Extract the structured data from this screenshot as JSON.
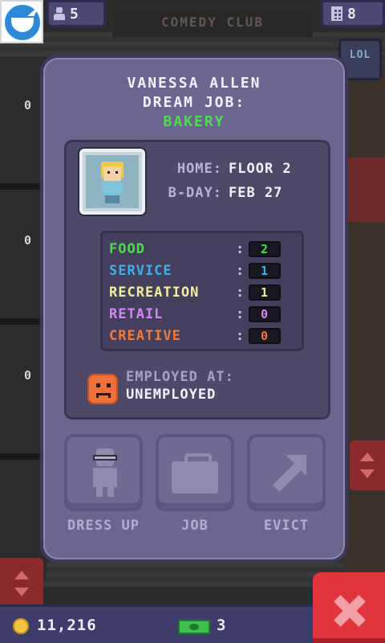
{
  "hud": {
    "population": "5",
    "floors": "8",
    "floor_sign": "COMEDY CLUB",
    "side_sign": "LOL"
  },
  "background": {
    "floor_numbers": [
      "0",
      "0",
      "0"
    ]
  },
  "resident": {
    "name": "VANESSA ALLEN",
    "dream_job_label": "DREAM JOB:",
    "dream_job": "BAKERY",
    "home_label": "HOME:",
    "home_value": "FLOOR 2",
    "bday_label": "B-DAY:",
    "bday_value": "FEB 27"
  },
  "stats": [
    {
      "name": "FOOD",
      "value": "2",
      "color": "#4fdb4f"
    },
    {
      "name": "SERVICE",
      "value": "1",
      "color": "#3fb2e8"
    },
    {
      "name": "RECREATION",
      "value": "1",
      "color": "#f2ee9a"
    },
    {
      "name": "RETAIL",
      "value": "0",
      "color": "#d28af2"
    },
    {
      "name": "CREATIVE",
      "value": "0",
      "color": "#f27a3a"
    }
  ],
  "stat_colon": ":",
  "employment": {
    "label": "EMPLOYED AT:",
    "value": "UNEMPLOYED",
    "mood_icon": "sad-face-icon"
  },
  "actions": {
    "dress_up": "DRESS UP",
    "job": "JOB",
    "evict": "EVICT"
  },
  "footer": {
    "coins": "11,216",
    "bux": "3"
  },
  "colors": {
    "panel": "#6b668f",
    "accent_green": "#4fdb4f",
    "close_red": "#e1343f"
  }
}
